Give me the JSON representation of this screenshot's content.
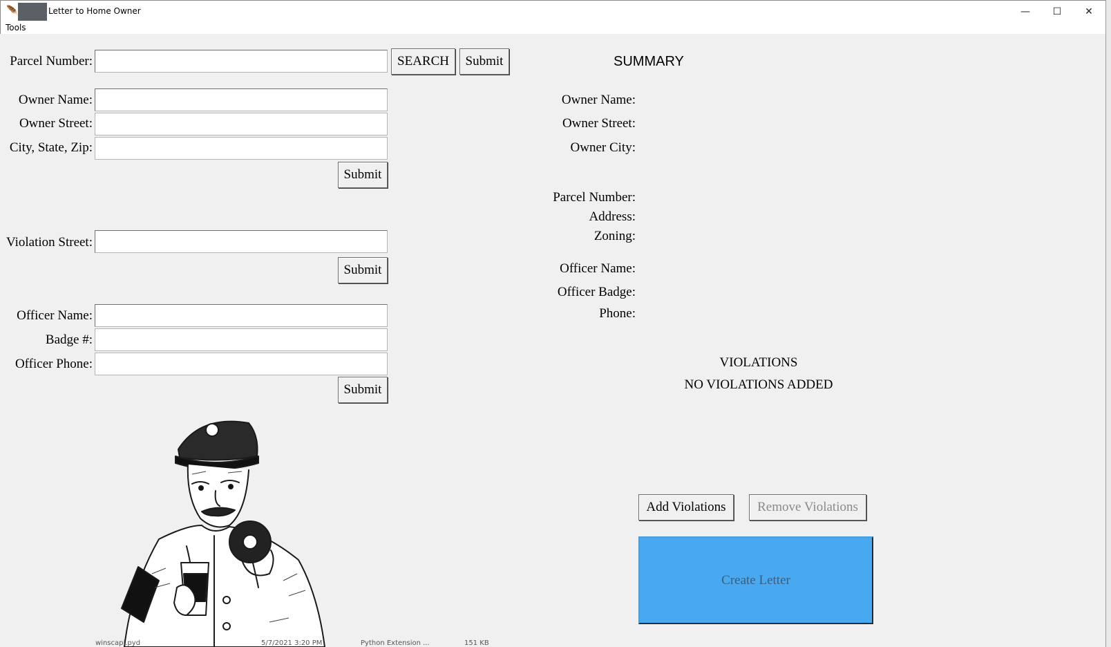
{
  "window": {
    "title": "Letter to Home Owner",
    "icon": "feather-icon",
    "controls": {
      "minimize": "—",
      "maximize": "☐",
      "close": "✕"
    }
  },
  "menu": {
    "items": [
      "Tools"
    ]
  },
  "left_form": {
    "parcel_label": "Parcel Number:",
    "parcel_value": "",
    "search_label": "SEARCH",
    "submit_label": "Submit",
    "owner_name_label": "Owner Name:",
    "owner_name_value": "",
    "owner_street_label": "Owner Street:",
    "owner_street_value": "",
    "city_state_zip_label": "City, State, Zip:",
    "city_state_zip_value": "",
    "violation_street_label": "Violation Street:",
    "violation_street_value": "",
    "officer_name_label": "Officer Name:",
    "officer_name_value": "",
    "badge_label": "Badge #:",
    "badge_value": "",
    "officer_phone_label": "Officer Phone:",
    "officer_phone_value": ""
  },
  "summary": {
    "title": "SUMMARY",
    "owner_name": "Owner Name:",
    "owner_street": "Owner Street:",
    "owner_city": "Owner City:",
    "parcel_number": "Parcel Number:",
    "address": "Address:",
    "zoning": "Zoning:",
    "officer_name": "Officer Name:",
    "officer_badge": "Officer Badge:",
    "phone": "Phone:"
  },
  "violations": {
    "title": "VIOLATIONS",
    "empty_text": "NO VIOLATIONS ADDED",
    "add_label": "Add Violations",
    "remove_label": "Remove Violations"
  },
  "create_letter": {
    "label": "Create Letter",
    "color": "#48a8f0"
  },
  "taskbar_peek": {
    "file": "winscapi.pyd",
    "date": "5/7/2021 3:20 PM",
    "type": "Python Extension ...",
    "size": "151 KB"
  }
}
